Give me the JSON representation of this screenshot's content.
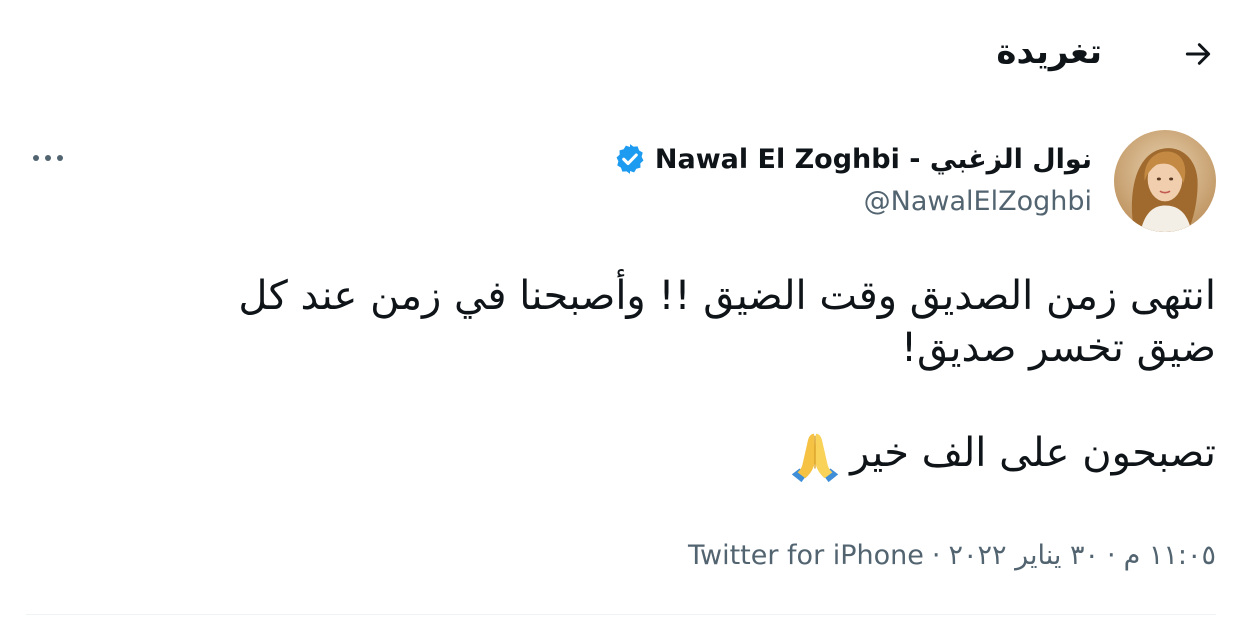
{
  "header": {
    "title": "تغريدة",
    "back_icon": "arrow-right-icon"
  },
  "author": {
    "display_name": "نوال الزغبي - Nawal El Zoghbi",
    "handle": "@NawalElZoghbi",
    "verified": true,
    "verified_icon": "verified-badge-icon",
    "more_icon": "more-horizontal-icon",
    "avatar_icon": "avatar"
  },
  "tweet": {
    "lines": [
      "انتهى زمن الصديق وقت الضيق !! وأصبحنا في زمن عند كل",
      "ضيق تخسر صديق!"
    ],
    "closing": "تصبحون على الف خير",
    "emoji_icon": "folded-hands-icon"
  },
  "meta": {
    "time": "١١:٠٥ م",
    "separator": "·",
    "date": "٣٠ يناير ٢٠٢٢",
    "source": "Twitter for iPhone"
  },
  "colors": {
    "text": "#0f1419",
    "secondary": "#536471",
    "verified": "#1d9bf0",
    "divider": "#eff3f4"
  }
}
